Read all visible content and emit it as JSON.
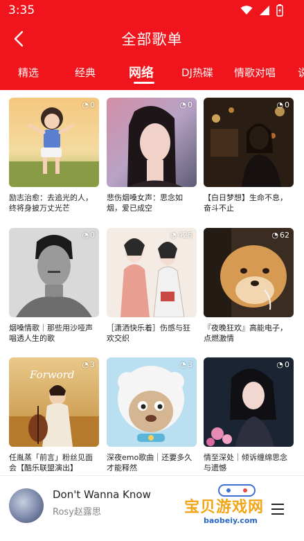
{
  "status_bar": {
    "time": "3:35"
  },
  "header": {
    "title": "全部歌单"
  },
  "tabs": [
    {
      "label": "精选"
    },
    {
      "label": "经典"
    },
    {
      "label": "网络"
    },
    {
      "label": "DJ热碟"
    },
    {
      "label": "情歌对唱"
    },
    {
      "label": "说"
    }
  ],
  "active_tab": "网络",
  "playlists": [
    {
      "count": "0",
      "caption": "励志治愈：去追光的人，终将身披万丈光芒"
    },
    {
      "count": "0",
      "caption": "悲伤烟嗓女声：思念如烟，爱已成空"
    },
    {
      "count": "0",
      "caption": "【白日梦想】生命不息，奋斗不止"
    },
    {
      "count": "0",
      "caption": "烟嗓情歌｜那些用沙哑声唱透人生的歌"
    },
    {
      "count": "425",
      "caption": "［潇洒快乐着］伤感与狂欢交织"
    },
    {
      "count": "62",
      "caption": "『夜晚狂欢』高能电子，点燃激情"
    },
    {
      "count": "3",
      "caption": "任胤蒸「前言」粉丝见面会【酷乐联盟演出】"
    },
    {
      "count": "3",
      "caption": "深夜emo歌曲｜还要多久才能释然"
    },
    {
      "count": "0",
      "caption": "情至深处｜倾诉缠绵思念与遗憾"
    }
  ],
  "cover_text": {
    "card7_script": "Forword"
  },
  "player": {
    "song": "Don't Wanna Know",
    "artist": "Rosy赵露思"
  },
  "watermark": {
    "text": "宝贝游戏网",
    "url": "baobeiy.com"
  },
  "colors": {
    "brand_red": "#f0151c"
  }
}
